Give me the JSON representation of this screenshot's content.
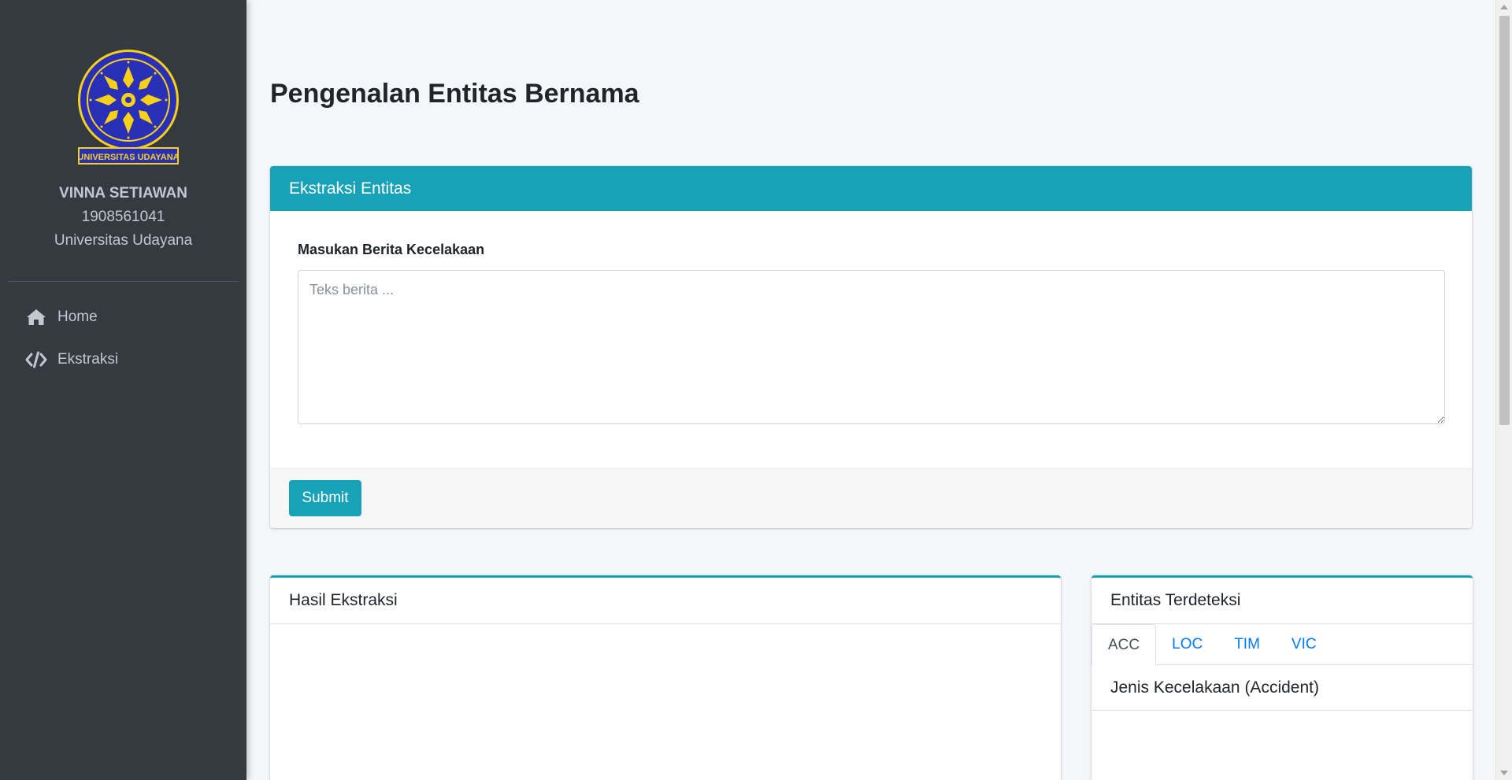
{
  "sidebar": {
    "logo_text": "UNIVERSITAS UDAYANA",
    "user": {
      "name": "VINNA SETIAWAN",
      "id": "1908561041",
      "university": "Universitas Udayana"
    },
    "items": [
      {
        "label": "Home",
        "icon": "home-icon"
      },
      {
        "label": "Ekstraksi",
        "icon": "code-icon"
      }
    ]
  },
  "main": {
    "title": "Pengenalan Entitas Bernama",
    "extract_card": {
      "header": "Ekstraksi Entitas",
      "field_label": "Masukan Berita Kecelakaan",
      "textarea_value": "",
      "textarea_placeholder": "Teks berita ...",
      "submit_label": "Submit"
    },
    "result_card": {
      "header": "Hasil Ekstraksi"
    },
    "entities_card": {
      "header": "Entitas Terdeteksi",
      "tabs": [
        {
          "label": "ACC",
          "active": true
        },
        {
          "label": "LOC",
          "active": false
        },
        {
          "label": "TIM",
          "active": false
        },
        {
          "label": "VIC",
          "active": false
        }
      ],
      "active_pane_title": "Jenis Kecelakaan (Accident)"
    }
  },
  "colors": {
    "sidebar_bg": "#343a40",
    "accent": "#17a2b8",
    "link": "#007bff",
    "page_bg": "#f4f6f9",
    "logo_blue": "#2a2fb8",
    "logo_yellow": "#f7d117"
  }
}
